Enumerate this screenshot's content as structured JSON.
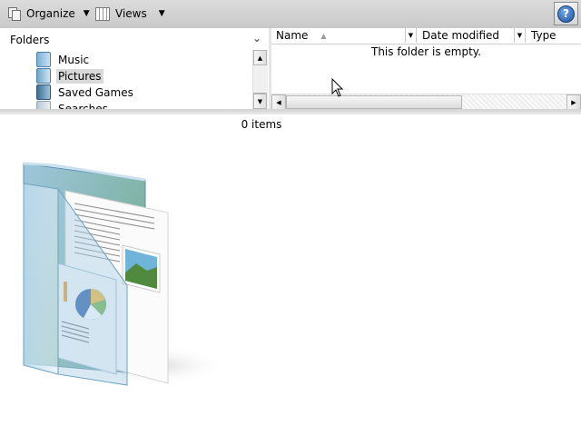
{
  "toolbar": {
    "organize_label": "Organize",
    "views_label": "Views",
    "organize_icon": "organize-icon",
    "views_icon": "views-icon",
    "help_icon": "help-icon",
    "help_glyph": "?"
  },
  "folders_pane": {
    "header": "Folders",
    "items": [
      {
        "label": "Music",
        "icon": "music-folder-icon",
        "selected": false
      },
      {
        "label": "Pictures",
        "icon": "pictures-folder-icon",
        "selected": true
      },
      {
        "label": "Saved Games",
        "icon": "saved-games-folder-icon",
        "selected": false
      },
      {
        "label": "Searches",
        "icon": "searches-folder-icon",
        "selected": false
      }
    ]
  },
  "file_list": {
    "columns": [
      "Name",
      "Date modified",
      "Type"
    ],
    "empty_message": "This folder is empty."
  },
  "status": {
    "items_count": "0 items"
  },
  "colors": {
    "toolbar_bg": "#d0d0d0",
    "selection_bg": "#d9d9d9",
    "help_blue": "#1d4f9a"
  }
}
